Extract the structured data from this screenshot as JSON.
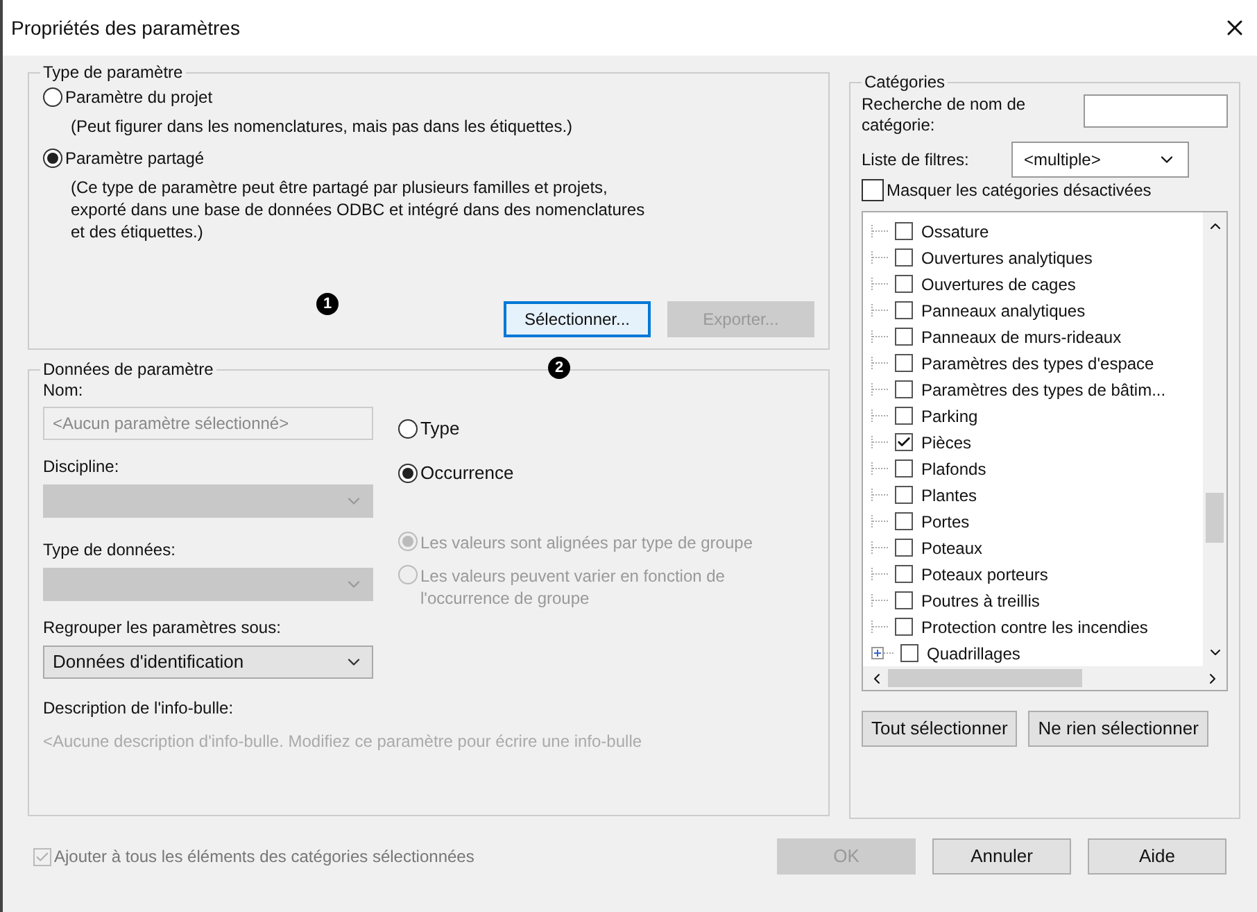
{
  "window": {
    "title": "Propriétés des paramètres"
  },
  "parameter_type": {
    "title": "Type de paramètre",
    "callout": "1",
    "options": [
      {
        "label": "Paramètre du projet",
        "selected": false,
        "description": [
          "(Peut figurer dans les nomenclatures, mais pas dans les étiquettes.)"
        ]
      },
      {
        "label": "Paramètre partagé",
        "selected": true,
        "description": [
          "(Ce type de paramètre peut être partagé par plusieurs familles et projets,",
          "exporté dans une base de données ODBC et intégré dans des nomenclatures",
          "et des étiquettes.)"
        ]
      }
    ],
    "buttons": [
      {
        "label": "Sélectionner...",
        "disabled": false
      },
      {
        "label": "Exporter...",
        "disabled": true
      }
    ]
  },
  "parameter_data": {
    "title": "Données de paramètre",
    "callout": "2",
    "name": {
      "label": "Nom:",
      "placeholder": "<Aucun paramètre sélectionné>"
    },
    "discipline": {
      "label": "Discipline:",
      "disabled": true
    },
    "data_type": {
      "label": "Type de données:",
      "disabled": true
    },
    "group_under": {
      "label": "Regrouper les paramètres sous:",
      "value": "Données d'identification",
      "disabled": false
    },
    "instance_options": [
      {
        "label": "Type",
        "selected": false,
        "disabled": false
      },
      {
        "label": "Occurrence",
        "selected": true,
        "disabled": false
      }
    ],
    "group_options": [
      {
        "label": "Les valeurs sont alignées par type de groupe",
        "selected": true,
        "disabled": true
      },
      {
        "label": "Les valeurs peuvent varier en fonction de l'occurrence de groupe",
        "selected": false,
        "disabled": true
      }
    ],
    "tooltip": {
      "label": "Description de l'info-bulle:",
      "text": "<Aucune description d'info-bulle. Modifiez ce paramètre pour écrire une info-bulle"
    }
  },
  "add_to_all": {
    "label": "Ajouter à tous les éléments des catégories sélectionnées",
    "checked": true,
    "disabled": true
  },
  "categories": {
    "title": "Catégories",
    "search_label": "Recherche de nom de catégorie:",
    "filter_label": "Liste de filtres:",
    "filter_value": "<multiple>",
    "hide_disabled": {
      "label": "Masquer les catégories désactivées",
      "checked": false
    },
    "items": [
      {
        "label": "Ossature",
        "checked": false,
        "has_children": false
      },
      {
        "label": "Ouvertures analytiques",
        "checked": false,
        "has_children": false
      },
      {
        "label": "Ouvertures de cages",
        "checked": false,
        "has_children": false
      },
      {
        "label": "Panneaux analytiques",
        "checked": false,
        "has_children": false
      },
      {
        "label": "Panneaux de murs-rideaux",
        "checked": false,
        "has_children": false
      },
      {
        "label": "Paramètres des types d'espace",
        "checked": false,
        "has_children": false
      },
      {
        "label": "Paramètres des types de bâtim...",
        "checked": false,
        "has_children": false
      },
      {
        "label": "Parking",
        "checked": false,
        "has_children": false
      },
      {
        "label": "Pièces",
        "checked": true,
        "has_children": false
      },
      {
        "label": "Plafonds",
        "checked": false,
        "has_children": false
      },
      {
        "label": "Plantes",
        "checked": false,
        "has_children": false
      },
      {
        "label": "Portes",
        "checked": false,
        "has_children": false
      },
      {
        "label": "Poteaux",
        "checked": false,
        "has_children": false
      },
      {
        "label": "Poteaux porteurs",
        "checked": false,
        "has_children": false
      },
      {
        "label": "Poutres à treillis",
        "checked": false,
        "has_children": false
      },
      {
        "label": "Protection contre les incendies",
        "checked": false,
        "has_children": false
      },
      {
        "label": "Quadrillages",
        "checked": false,
        "has_children": true
      }
    ],
    "buttons": [
      {
        "label": "Tout sélectionner"
      },
      {
        "label": "Ne rien sélectionner"
      }
    ]
  },
  "footer_buttons": [
    {
      "label": "OK",
      "disabled": true
    },
    {
      "label": "Annuler",
      "disabled": false
    },
    {
      "label": "Aide",
      "disabled": false
    }
  ]
}
